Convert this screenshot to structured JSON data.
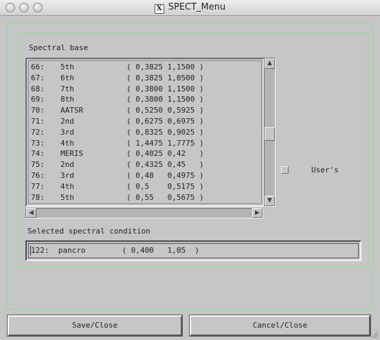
{
  "window": {
    "title": "SPECT_Menu",
    "title_icon": "X"
  },
  "spectral_base": {
    "label": "Spectral base",
    "rows": [
      {
        "idx": "66:",
        "name": "5th",
        "range": "( 0,3825 1,1500 )"
      },
      {
        "idx": "67:",
        "name": "6th",
        "range": "( 0,3825 1,0500 )"
      },
      {
        "idx": "68:",
        "name": "7th",
        "range": "( 0,3800 1,1500 )"
      },
      {
        "idx": "69:",
        "name": "8th",
        "range": "( 0,3800 1,1500 )"
      },
      {
        "idx": "70:",
        "name": "AATSR",
        "range": "( 0,5250 0,5925 )"
      },
      {
        "idx": "71:",
        "name": "2nd",
        "range": "( 0,6275 0,6975 )"
      },
      {
        "idx": "72:",
        "name": "3rd",
        "range": "( 0,8325 0,9025 )"
      },
      {
        "idx": "73:",
        "name": "4th",
        "range": "( 1,4475 1,7775 )"
      },
      {
        "idx": "74:",
        "name": "MERIS",
        "range": "( 0,4025 0,42   )"
      },
      {
        "idx": "75:",
        "name": "2nd",
        "range": "( 0,4325 0,45   )"
      },
      {
        "idx": "76:",
        "name": "3rd",
        "range": "( 0,48   0,4975 )"
      },
      {
        "idx": "77:",
        "name": "4th",
        "range": "( 0,5    0,5175 )"
      },
      {
        "idx": "78:",
        "name": "5th",
        "range": "( 0,55   0,5675 )"
      }
    ]
  },
  "users_toggle": {
    "label": "User's",
    "checked": false
  },
  "selected": {
    "label": "Selected spectral condition",
    "value": "122:  pancro        ( 0,400   1,05  )"
  },
  "buttons": {
    "save": "Save/Close",
    "cancel": "Cancel/Close"
  }
}
